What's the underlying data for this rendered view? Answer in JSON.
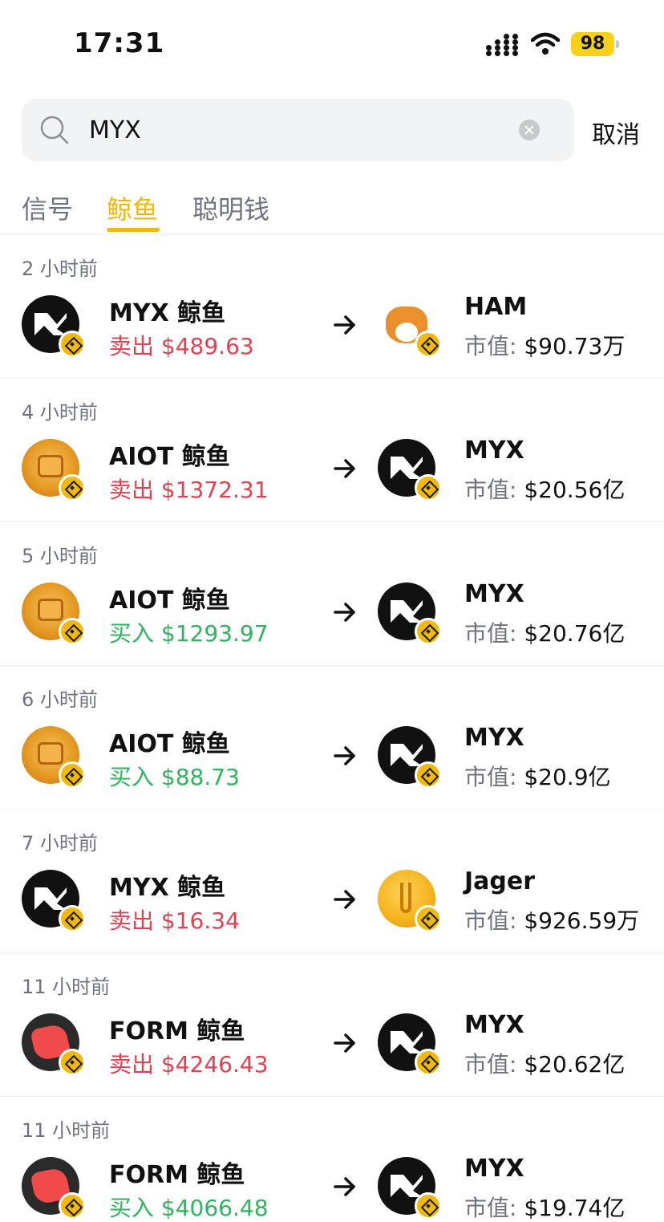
{
  "status_bar": {
    "time": "17:31",
    "battery": "98"
  },
  "search": {
    "value": "MYX",
    "placeholder": "",
    "cancel_label": "取消"
  },
  "tabs": [
    {
      "label": "信号",
      "active": false
    },
    {
      "label": "鲸鱼",
      "active": true
    },
    {
      "label": "聪明钱",
      "active": false
    }
  ],
  "colors": {
    "accent": "#f0b90b",
    "sell": "#e5404f",
    "buy": "#2db55d",
    "muted": "#6c7280"
  },
  "feed": [
    {
      "time": "2 小时前",
      "src": "MYX 鲸鱼",
      "src_icon": "myx-token-icon",
      "action": "卖出",
      "amount": "$489.63",
      "side": "sell",
      "dst": "HAM",
      "dst_icon": "ham-token-icon",
      "cap_label": "市值:",
      "cap_value": "$90.73万"
    },
    {
      "time": "4 小时前",
      "src": "AIOT 鲸鱼",
      "src_icon": "aiot-token-icon",
      "action": "卖出",
      "amount": "$1372.31",
      "side": "sell",
      "dst": "MYX",
      "dst_icon": "myx-token-icon",
      "cap_label": "市值:",
      "cap_value": "$20.56亿"
    },
    {
      "time": "5 小时前",
      "src": "AIOT 鲸鱼",
      "src_icon": "aiot-token-icon",
      "action": "买入",
      "amount": "$1293.97",
      "side": "buy",
      "dst": "MYX",
      "dst_icon": "myx-token-icon",
      "cap_label": "市值:",
      "cap_value": "$20.76亿"
    },
    {
      "time": "6 小时前",
      "src": "AIOT 鲸鱼",
      "src_icon": "aiot-token-icon",
      "action": "买入",
      "amount": "$88.73",
      "side": "buy",
      "dst": "MYX",
      "dst_icon": "myx-token-icon",
      "cap_label": "市值:",
      "cap_value": "$20.9亿"
    },
    {
      "time": "7 小时前",
      "src": "MYX 鲸鱼",
      "src_icon": "myx-token-icon",
      "action": "卖出",
      "amount": "$16.34",
      "side": "sell",
      "dst": "Jager",
      "dst_icon": "jager-token-icon",
      "cap_label": "市值:",
      "cap_value": "$926.59万"
    },
    {
      "time": "11 小时前",
      "src": "FORM 鲸鱼",
      "src_icon": "form-token-icon",
      "action": "卖出",
      "amount": "$4246.43",
      "side": "sell",
      "dst": "MYX",
      "dst_icon": "myx-token-icon",
      "cap_label": "市值:",
      "cap_value": "$20.62亿"
    },
    {
      "time": "11 小时前",
      "src": "FORM 鲸鱼",
      "src_icon": "form-token-icon",
      "action": "买入",
      "amount": "$4066.48",
      "side": "buy",
      "dst": "MYX",
      "dst_icon": "myx-token-icon",
      "cap_label": "市值:",
      "cap_value": "$19.74亿"
    }
  ]
}
